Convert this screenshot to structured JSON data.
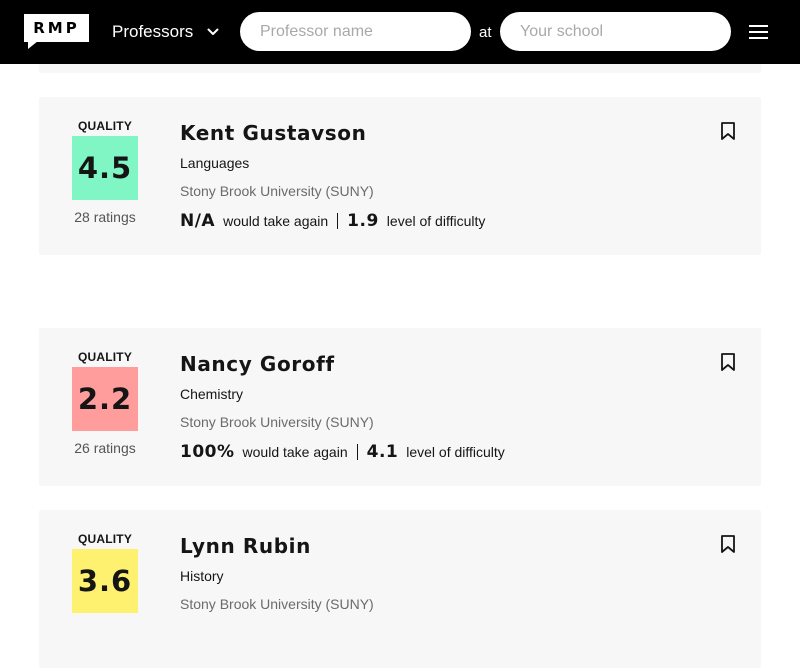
{
  "header": {
    "logo_text": "RMP",
    "nav_label": "Professors",
    "search_professor_placeholder": "Professor name",
    "at_label": "at",
    "search_school_placeholder": "Your school"
  },
  "colors": {
    "header_bg": "#000000",
    "card_bg": "#f7f7f7",
    "quality_high": "#7ff6c3",
    "quality_low": "#ff9c9c",
    "quality_mid": "#fff170"
  },
  "professors": [
    {
      "quality_label": "QUALITY",
      "rating": "4.5",
      "rating_color": "#7ff6c3",
      "ratings_count": "28 ratings",
      "name": "Kent Gustavson",
      "department": "Languages",
      "school": "Stony Brook University (SUNY)",
      "would_take_again": "N/A",
      "would_take_again_label": "would take again",
      "difficulty": "1.9",
      "difficulty_label": "level of difficulty"
    },
    {
      "quality_label": "QUALITY",
      "rating": "2.2",
      "rating_color": "#ff9c9c",
      "ratings_count": "26 ratings",
      "name": "Nancy Goroff",
      "department": "Chemistry",
      "school": "Stony Brook University (SUNY)",
      "would_take_again": "100%",
      "would_take_again_label": "would take again",
      "difficulty": "4.1",
      "difficulty_label": "level of difficulty"
    },
    {
      "quality_label": "QUALITY",
      "rating": "3.6",
      "rating_color": "#fff170",
      "ratings_count": "",
      "name": "Lynn Rubin",
      "department": "History",
      "school": "Stony Brook University (SUNY)"
    }
  ]
}
